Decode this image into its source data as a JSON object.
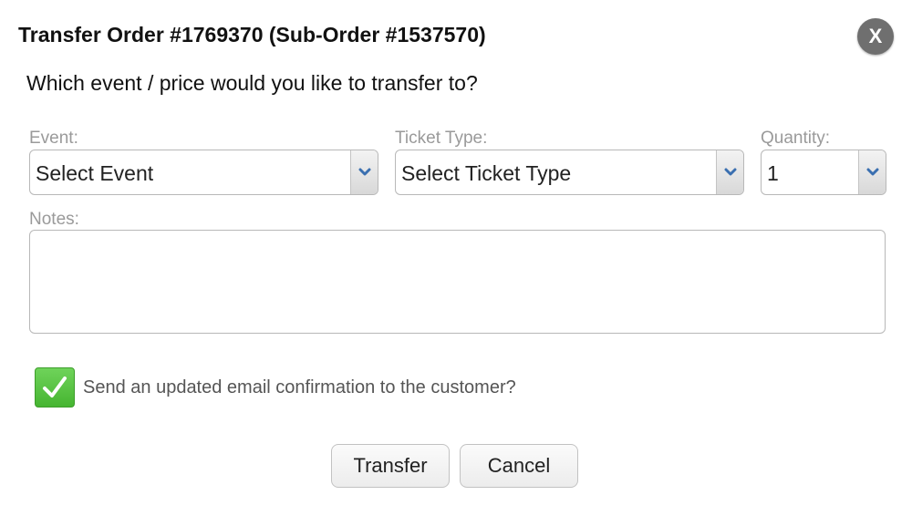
{
  "dialog": {
    "title": "Transfer Order #1769370 (Sub-Order #1537570)",
    "close_label": "X",
    "question": "Which event / price would you like to transfer to?"
  },
  "fields": {
    "event": {
      "label": "Event:",
      "value": "Select Event"
    },
    "ticket_type": {
      "label": "Ticket Type:",
      "value": "Select Ticket Type"
    },
    "quantity": {
      "label": "Quantity:",
      "value": "1"
    },
    "notes": {
      "label": "Notes:",
      "value": ""
    }
  },
  "email_confirmation": {
    "checked": true,
    "label": "Send an updated email confirmation to the customer?"
  },
  "buttons": {
    "transfer": "Transfer",
    "cancel": "Cancel"
  },
  "colors": {
    "checkbox_green": "#52c13b",
    "arrow_blue": "#3a6fb0",
    "close_gray": "#6f6f6f",
    "label_gray": "#9a9a9a"
  },
  "icons": {
    "close": "close-icon",
    "dropdown": "chevron-down-icon",
    "check": "checkmark-icon"
  }
}
